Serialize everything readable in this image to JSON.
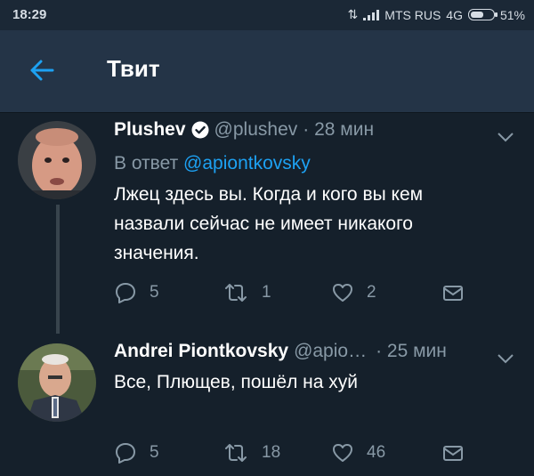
{
  "status_bar": {
    "time": "18:29",
    "carrier": "MTS RUS",
    "network": "4G",
    "battery": "51%",
    "battery_level": 0.51
  },
  "header": {
    "title": "Твит"
  },
  "tweets": [
    {
      "name": "Plushev",
      "verified": true,
      "handle": "@plushev",
      "time": "· 28 мин",
      "reply_prefix": "В ответ",
      "reply_handle": "@apiontkovsky",
      "text_lines": [
        "Лжец здесь вы. Когда и кого вы кем",
        "назвали сейчас не имеет никакого",
        "значения."
      ],
      "replies": "5",
      "retweets": "1",
      "likes": "2"
    },
    {
      "name": "Andrei Piontkovsky",
      "verified": false,
      "handle": "@apio…",
      "time": "· 25 мин",
      "text_lines": [
        "Все, Плющев, пошёл на хуй"
      ],
      "replies": "5",
      "retweets": "18",
      "likes": "46"
    }
  ]
}
